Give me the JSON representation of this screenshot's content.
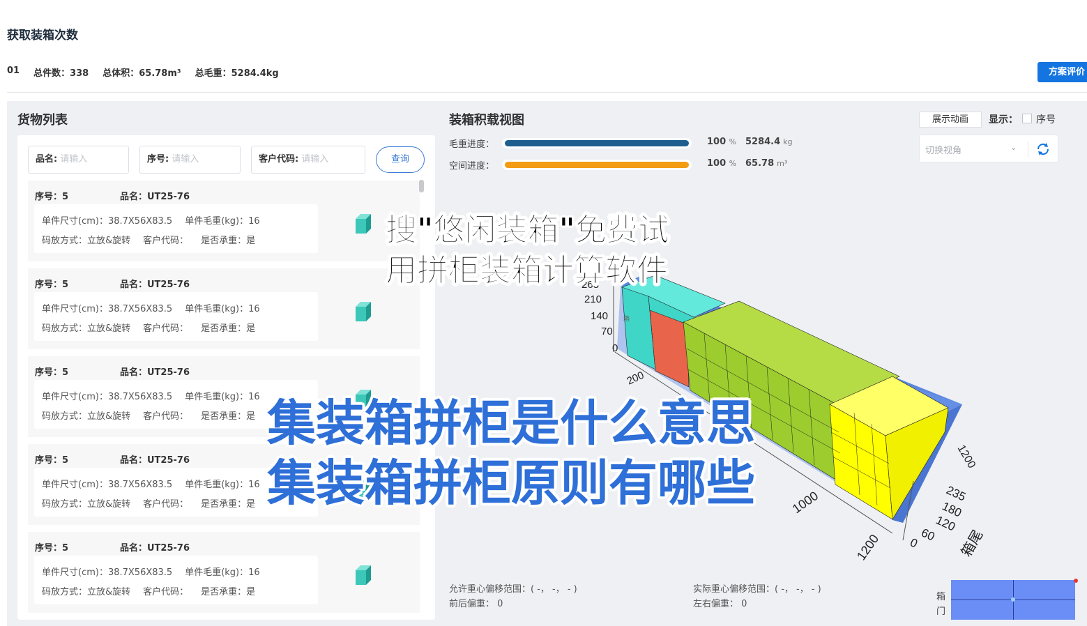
{
  "header": {
    "title": "获取装箱次数",
    "index": "01",
    "total_count": "总件数：338",
    "total_volume": "总体积：65.78m³",
    "total_weight": "总毛重：5284.4kg",
    "evaluate_button": "方案评价"
  },
  "cargo": {
    "title": "货物列表",
    "filters": [
      {
        "label": "品名:",
        "placeholder": "请输入"
      },
      {
        "label": "序号:",
        "placeholder": "请输入"
      },
      {
        "label": "客户代码:",
        "placeholder": "请输入"
      }
    ],
    "query_button": "查询",
    "items": [
      {
        "seq": "序号：5",
        "name": "品名：UT25-76",
        "size": "单件尺寸(cm)：38.7X56X83.5",
        "weight": "单件毛重(kg)：16",
        "stack": "码放方式：立放&旋转",
        "customer": "客户代码：",
        "bearing": "是否承重：是"
      },
      {
        "seq": "序号：5",
        "name": "品名：UT25-76",
        "size": "单件尺寸(cm)：38.7X56X83.5",
        "weight": "单件毛重(kg)：16",
        "stack": "码放方式：立放&旋转",
        "customer": "客户代码：",
        "bearing": "是否承重：是"
      },
      {
        "seq": "序号：5",
        "name": "品名：UT25-76",
        "size": "单件尺寸(cm)：38.7X56X83.5",
        "weight": "单件毛重(kg)：16",
        "stack": "码放方式：立放&旋转",
        "customer": "客户代码：",
        "bearing": "是否承重：是"
      },
      {
        "seq": "序号：5",
        "name": "品名：UT25-76",
        "size": "单件尺寸(cm)：38.7X56X83.5",
        "weight": "单件毛重(kg)：16",
        "stack": "码放方式：立放&旋转",
        "customer": "客户代码：",
        "bearing": "是否承重：是"
      },
      {
        "seq": "序号：5",
        "name": "品名：UT25-76",
        "size": "单件尺寸(cm)：38.7X56X83.5",
        "weight": "单件毛重(kg)：16",
        "stack": "码放方式：立放&旋转",
        "customer": "客户代码：",
        "bearing": "是否承重：是"
      }
    ],
    "icon_color": "#3cc7b8"
  },
  "view": {
    "title": "装箱积载视图",
    "weight_progress": {
      "label": "毛重进度：",
      "percent": 100,
      "percent_text": "100",
      "percent_unit": "%",
      "value": "5284.4",
      "unit": "kg",
      "color": "#1f5f8f"
    },
    "space_progress": {
      "label": "空间进度：",
      "percent": 100,
      "percent_text": "100",
      "percent_unit": "%",
      "value": "65.78",
      "unit": "m³",
      "color": "#f39c12"
    },
    "animation_button": "展示动画",
    "display_label": "显示：",
    "seq_checkbox": "序号",
    "view_select_placeholder": "切换视角",
    "axis": {
      "height_ticks": [
        "268",
        "210",
        "140",
        "70",
        "0"
      ],
      "length_ticks": [
        "200",
        "1000",
        "1200"
      ],
      "width_ticks": [
        "235",
        "180",
        "120",
        "60",
        "0"
      ],
      "right_tick": "1200",
      "tail_label": "箱尾",
      "front_label": "箱"
    },
    "colors": {
      "container": "#5b87e0",
      "teal": "#3fd6c8",
      "red": "#e8644a",
      "green": "#9ccc2e",
      "yellow": "#ffff00"
    }
  },
  "cog": {
    "allowed": "允许重心偏移范围：( -， -， - )",
    "front_back": "前后偏重：  0",
    "actual": "实际重心偏移范围：( -， -， - )",
    "left_right": "左右偏重：  0"
  },
  "door": {
    "line1": "箱",
    "line2": "门"
  },
  "overlay": {
    "promo_line1": "搜\"悠闲装箱\"免费试",
    "promo_line2": "用拼柜装箱计算软件",
    "headline_line1": "集装箱拼柜是什么意思",
    "headline_line2": "集装箱拼柜原则有哪些"
  }
}
